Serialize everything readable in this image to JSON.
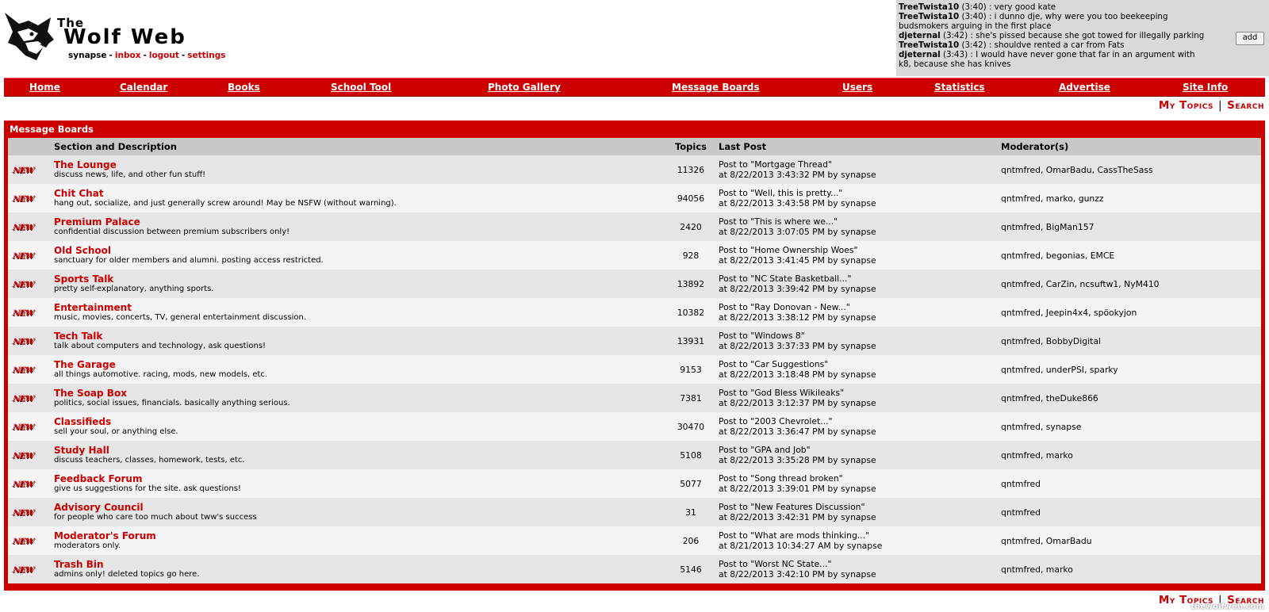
{
  "header": {
    "title_small": "The",
    "title": "Wolf Web",
    "username": "synapse",
    "links": [
      "inbox",
      "logout",
      "settings"
    ]
  },
  "shoutbox": {
    "add_label": "add",
    "lines": [
      {
        "user": "TreeTwista10",
        "time": "(3:40)",
        "text": ": very good kate"
      },
      {
        "user": "TreeTwista10",
        "time": "(3:40)",
        "text": ": i dunno dje, why were you too beekeeping budsmokers arguing in the first place"
      },
      {
        "user": "djeternal",
        "time": "(3:42)",
        "text": ": she's pissed because she got towed for illegally parking"
      },
      {
        "user": "TreeTwista10",
        "time": "(3:42)",
        "text": ": shouldve rented a car from Fats"
      },
      {
        "user": "djeternal",
        "time": "(3:43)",
        "text": ": I would have never gone that far in an argument with k8, because she has knives"
      }
    ]
  },
  "nav": {
    "items": [
      "Home",
      "Calendar",
      "Books",
      "School Tool",
      "Photo Gallery",
      "Message Boards",
      "Users",
      "Statistics",
      "Advertise",
      "Site Info"
    ]
  },
  "topic_links": {
    "my_topics": "My Topics",
    "search": "Search"
  },
  "watermark": "thewolfweb.com",
  "boards": {
    "panel_title": "Message Boards",
    "new_badge": "NEW",
    "columns": {
      "section": "Section and Description",
      "topics": "Topics",
      "last_post": "Last Post",
      "moderators": "Moderator(s)"
    },
    "rows": [
      {
        "name": "The Lounge",
        "desc": "discuss news, life, and other fun stuff!",
        "topics": "11326",
        "post": "Post to \"Mortgage Thread\"",
        "when": "at 8/22/2013 3:43:32 PM by synapse",
        "mods": "qntmfred, OmarBadu, CassTheSass"
      },
      {
        "name": "Chit Chat",
        "desc": "hang out, socialize, and just generally screw around! May be NSFW (without warning).",
        "topics": "94056",
        "post": "Post to \"Well, this is pretty...\"",
        "when": "at 8/22/2013 3:43:58 PM by synapse",
        "mods": "qntmfred, marko, gunzz"
      },
      {
        "name": "Premium Palace",
        "desc": "confidential discussion between premium subscribers only!",
        "topics": "2420",
        "post": "Post to \"This is where we...\"",
        "when": "at 8/22/2013 3:07:05 PM by synapse",
        "mods": "qntmfred, BigMan157"
      },
      {
        "name": "Old School",
        "desc": "sanctuary for older members and alumni. posting access restricted.",
        "topics": "928",
        "post": "Post to \"Home Ownership Woes\"",
        "when": "at 8/22/2013 3:41:45 PM by synapse",
        "mods": "qntmfred, begonias, EMCE"
      },
      {
        "name": "Sports Talk",
        "desc": "pretty self-explanatory, anything sports.",
        "topics": "13892",
        "post": "Post to \"NC State Basketball...\"",
        "when": "at 8/22/2013 3:39:42 PM by synapse",
        "mods": "qntmfred, CarZin, ncsuftw1, NyM410"
      },
      {
        "name": "Entertainment",
        "desc": "music, movies, concerts, TV, general entertainment discussion.",
        "topics": "10382",
        "post": "Post to \"Ray Donovan - New...\"",
        "when": "at 8/22/2013 3:38:12 PM by synapse",
        "mods": "qntmfred, Jeepin4x4, spöokyjon"
      },
      {
        "name": "Tech Talk",
        "desc": "talk about computers and technology, ask questions!",
        "topics": "13931",
        "post": "Post to \"Windows 8\"",
        "when": "at 8/22/2013 3:37:33 PM by synapse",
        "mods": "qntmfred, BobbyDigital"
      },
      {
        "name": "The Garage",
        "desc": "all things automotive. racing, mods, new models, etc.",
        "topics": "9153",
        "post": "Post to \"Car Suggestions\"",
        "when": "at 8/22/2013 3:18:48 PM by synapse",
        "mods": "qntmfred, underPSI, sparky"
      },
      {
        "name": "The Soap Box",
        "desc": "politics, social issues, financials. basically anything serious.",
        "topics": "7381",
        "post": "Post to \"God Bless Wikileaks\"",
        "when": "at 8/22/2013 3:12:37 PM by synapse",
        "mods": "qntmfred, theDuke866"
      },
      {
        "name": "Classifieds",
        "desc": "sell your soul, or anything else.",
        "topics": "30470",
        "post": "Post to \"2003 Chevrolet...\"",
        "when": "at 8/22/2013 3:36:47 PM by synapse",
        "mods": "qntmfred, synapse"
      },
      {
        "name": "Study Hall",
        "desc": "discuss teachers, classes, homework, tests, etc.",
        "topics": "5108",
        "post": "Post to \"GPA and Job\"",
        "when": "at 8/22/2013 3:35:28 PM by synapse",
        "mods": "qntmfred, marko"
      },
      {
        "name": "Feedback Forum",
        "desc": "give us suggestions for the site. ask questions!",
        "topics": "5077",
        "post": "Post to \"Song thread broken\"",
        "when": "at 8/22/2013 3:39:01 PM by synapse",
        "mods": "qntmfred"
      },
      {
        "name": "Advisory Council",
        "desc": "for people who care too much about tww's success",
        "topics": "31",
        "post": "Post to \"New Features Discussion\"",
        "when": "at 8/22/2013 3:42:31 PM by synapse",
        "mods": "qntmfred"
      },
      {
        "name": "Moderator's Forum",
        "desc": "moderators only.",
        "topics": "206",
        "post": "Post to \"What are mods thinking...\"",
        "when": "at 8/21/2013 10:34:27 AM by synapse",
        "mods": "qntmfred, OmarBadu"
      },
      {
        "name": "Trash Bin",
        "desc": "admins only! deleted topics go here.",
        "topics": "5146",
        "post": "Post to \"Worst NC State...\"",
        "when": "at 8/22/2013 3:42:10 PM by synapse",
        "mods": "qntmfred, marko"
      }
    ]
  }
}
